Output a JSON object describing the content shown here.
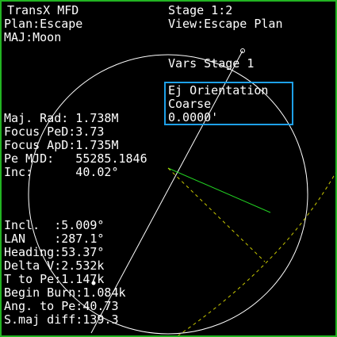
{
  "header": {
    "title": "TransX MFD",
    "plan": "Plan:Escape",
    "major": "MAJ:Moon",
    "stage": "Stage 1:2",
    "view": "View:Escape Plan",
    "vars": "Vars Stage 1"
  },
  "selection": {
    "name": "Ej Orientation",
    "mode": "Coarse",
    "value": "0.0000'"
  },
  "orbit_params": [
    "Maj. Rad: 1.738M",
    "Focus PeD:3.73",
    "Focus ApD:1.735M",
    "Pe MJD:   55285.1846",
    "Inc:      40.02°"
  ],
  "burn_params": [
    "Incl.  :5.009°",
    "LAN    :287.1°",
    "Heading:53.37°",
    "Delta V:2.532k",
    "T to Pe:1.147k",
    "Begin Burn:1.084k",
    "Ang. to Pe:40.73",
    "S.maj diff:139.3"
  ],
  "colors": {
    "frame": "#22b422",
    "text": "#ffffff",
    "selection_box": "#1ea0e8",
    "orbit": "#ffffff",
    "velocity_vector": "#22d222",
    "target_orbit": "#c8c800"
  }
}
